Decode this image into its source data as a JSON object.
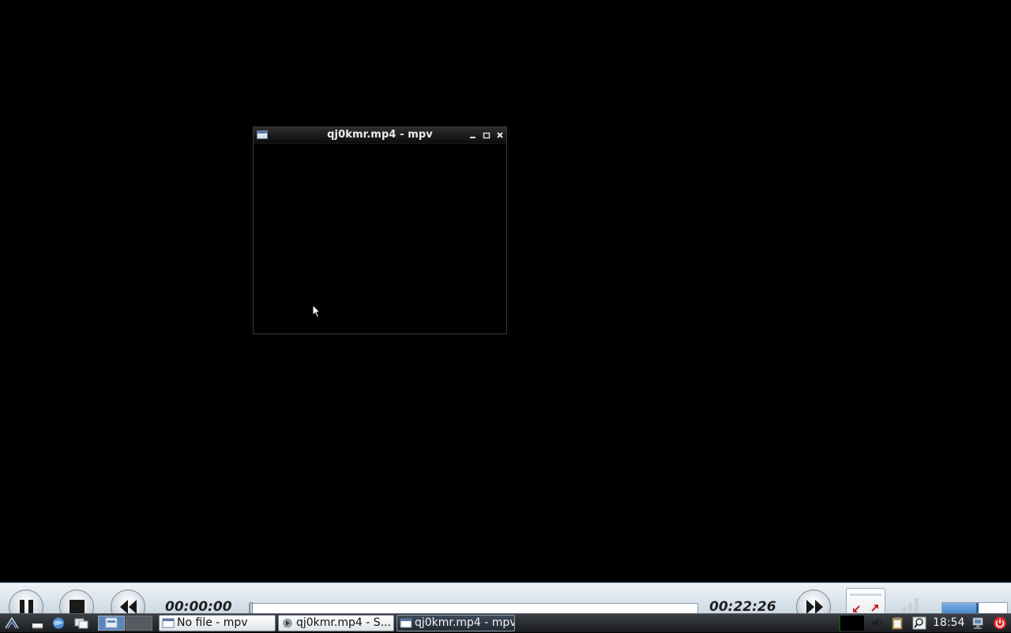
{
  "mpv_window": {
    "title": "qj0kmr.mp4 - mpv",
    "minimize": "_",
    "maximize": "▫",
    "close": "×"
  },
  "player_controls": {
    "elapsed": "00:00:00",
    "total": "00:22:26",
    "progress_fraction": 0.0,
    "volume_fraction": 0.55
  },
  "taskbar": {
    "tasks": [
      {
        "label": "No file - mpv",
        "icon": "window-icon",
        "active": false
      },
      {
        "label": "qj0kmr.mp4 - S...",
        "icon": "smplayer-icon",
        "active": false
      },
      {
        "label": "qj0kmr.mp4 - mpv",
        "icon": "window-icon",
        "active": true
      }
    ],
    "clock": "18:54"
  },
  "colors": {
    "desktop_background": "#000000",
    "controller_bar": "#dde6ee",
    "taskbar": "#2a2d31",
    "active_task": "#2e3845",
    "desktop_switch_active": "#5d86b6",
    "power": "#e0262a"
  },
  "icons": {
    "launchers": [
      "start-menu-icon",
      "files-launcher-icon",
      "browser-launcher-icon",
      "windows-launcher-icon"
    ],
    "tray": [
      "speaker-icon",
      "clipboard-icon",
      "search-icon",
      "network-icon",
      "power-icon"
    ],
    "controller": [
      "pause-icon",
      "stop-icon",
      "rewind-icon",
      "fast-forward-icon",
      "fullscreen-icon",
      "volume-icon"
    ]
  }
}
